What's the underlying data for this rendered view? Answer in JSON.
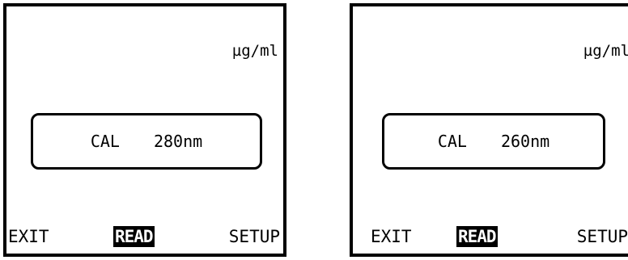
{
  "screens": [
    {
      "unit": "µg/ml",
      "cal_label": "CAL",
      "wavelength": "280nm",
      "softkeys": {
        "exit": "EXIT",
        "read": "READ",
        "setup": "SETUP"
      }
    },
    {
      "unit": "µg/ml",
      "cal_label": "CAL",
      "wavelength": "260nm",
      "softkeys": {
        "exit": "EXIT",
        "read": "READ",
        "setup": "SETUP"
      }
    }
  ],
  "colors": {
    "foreground": "#000000",
    "background": "#ffffff",
    "highlight_text": "#ffffff"
  }
}
